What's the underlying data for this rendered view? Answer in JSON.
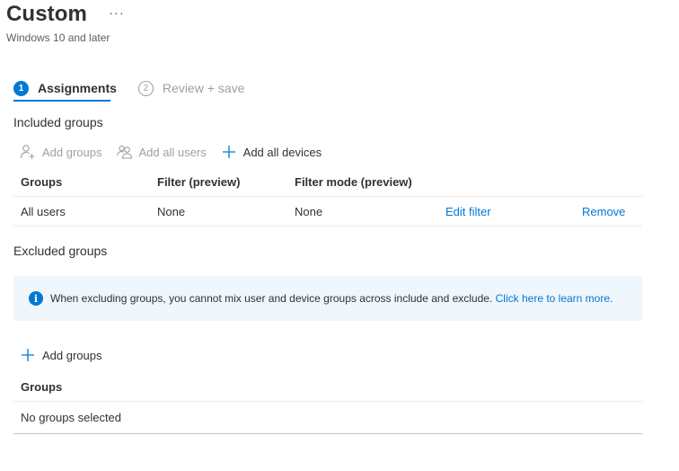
{
  "header": {
    "title": "Custom",
    "more_label": "···",
    "subtitle": "Windows 10 and later"
  },
  "steps": [
    {
      "number": "1",
      "label": "Assignments"
    },
    {
      "number": "2",
      "label": "Review + save"
    }
  ],
  "included": {
    "section_label": "Included groups",
    "toolbar": {
      "add_groups": "Add groups",
      "add_all_users": "Add all users",
      "add_all_devices": "Add all devices"
    },
    "columns": [
      "Groups",
      "Filter (preview)",
      "Filter mode (preview)"
    ],
    "rows": [
      {
        "group": "All users",
        "filter": "None",
        "filter_mode": "None",
        "edit_label": "Edit filter",
        "remove_label": "Remove"
      }
    ]
  },
  "excluded": {
    "section_label": "Excluded groups",
    "info_text": "When excluding groups, you cannot mix user and device groups across include and exclude.",
    "info_link": "Click here to learn more.",
    "add_groups": "Add groups",
    "column": "Groups",
    "empty_text": "No groups selected"
  },
  "colors": {
    "accent": "#0078d4",
    "disabled_text": "#a19f9d",
    "info_background": "#eff6fc"
  }
}
